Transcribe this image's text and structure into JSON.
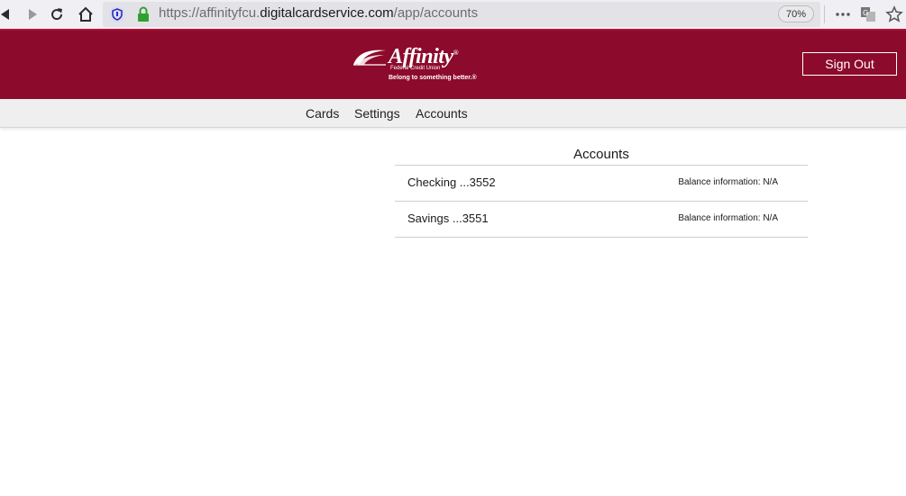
{
  "browser": {
    "url_prefix": "https://affinityfcu.",
    "url_host": "digitalcardservice.com",
    "url_path": "/app/accounts",
    "zoom": "70%",
    "icons": [
      "back-icon",
      "forward-icon",
      "reload-icon",
      "home-icon",
      "shield-icon",
      "lock-icon",
      "more-icon",
      "translate-icon",
      "star-icon"
    ]
  },
  "header": {
    "logo_name": "Affinity",
    "logo_trademark": "®",
    "logo_sub": "Federal Credit Union",
    "logo_tagline": "Belong to something better.®",
    "sign_out_label": "Sign Out",
    "brand_color": "#8c0a2b"
  },
  "nav": {
    "items": [
      {
        "label": "Cards"
      },
      {
        "label": "Settings"
      },
      {
        "label": "Accounts"
      }
    ]
  },
  "accounts": {
    "title": "Accounts",
    "rows": [
      {
        "name": "Checking ...3552",
        "balance": "Balance information: N/A"
      },
      {
        "name": "Savings ...3551",
        "balance": "Balance information: N/A"
      }
    ]
  }
}
